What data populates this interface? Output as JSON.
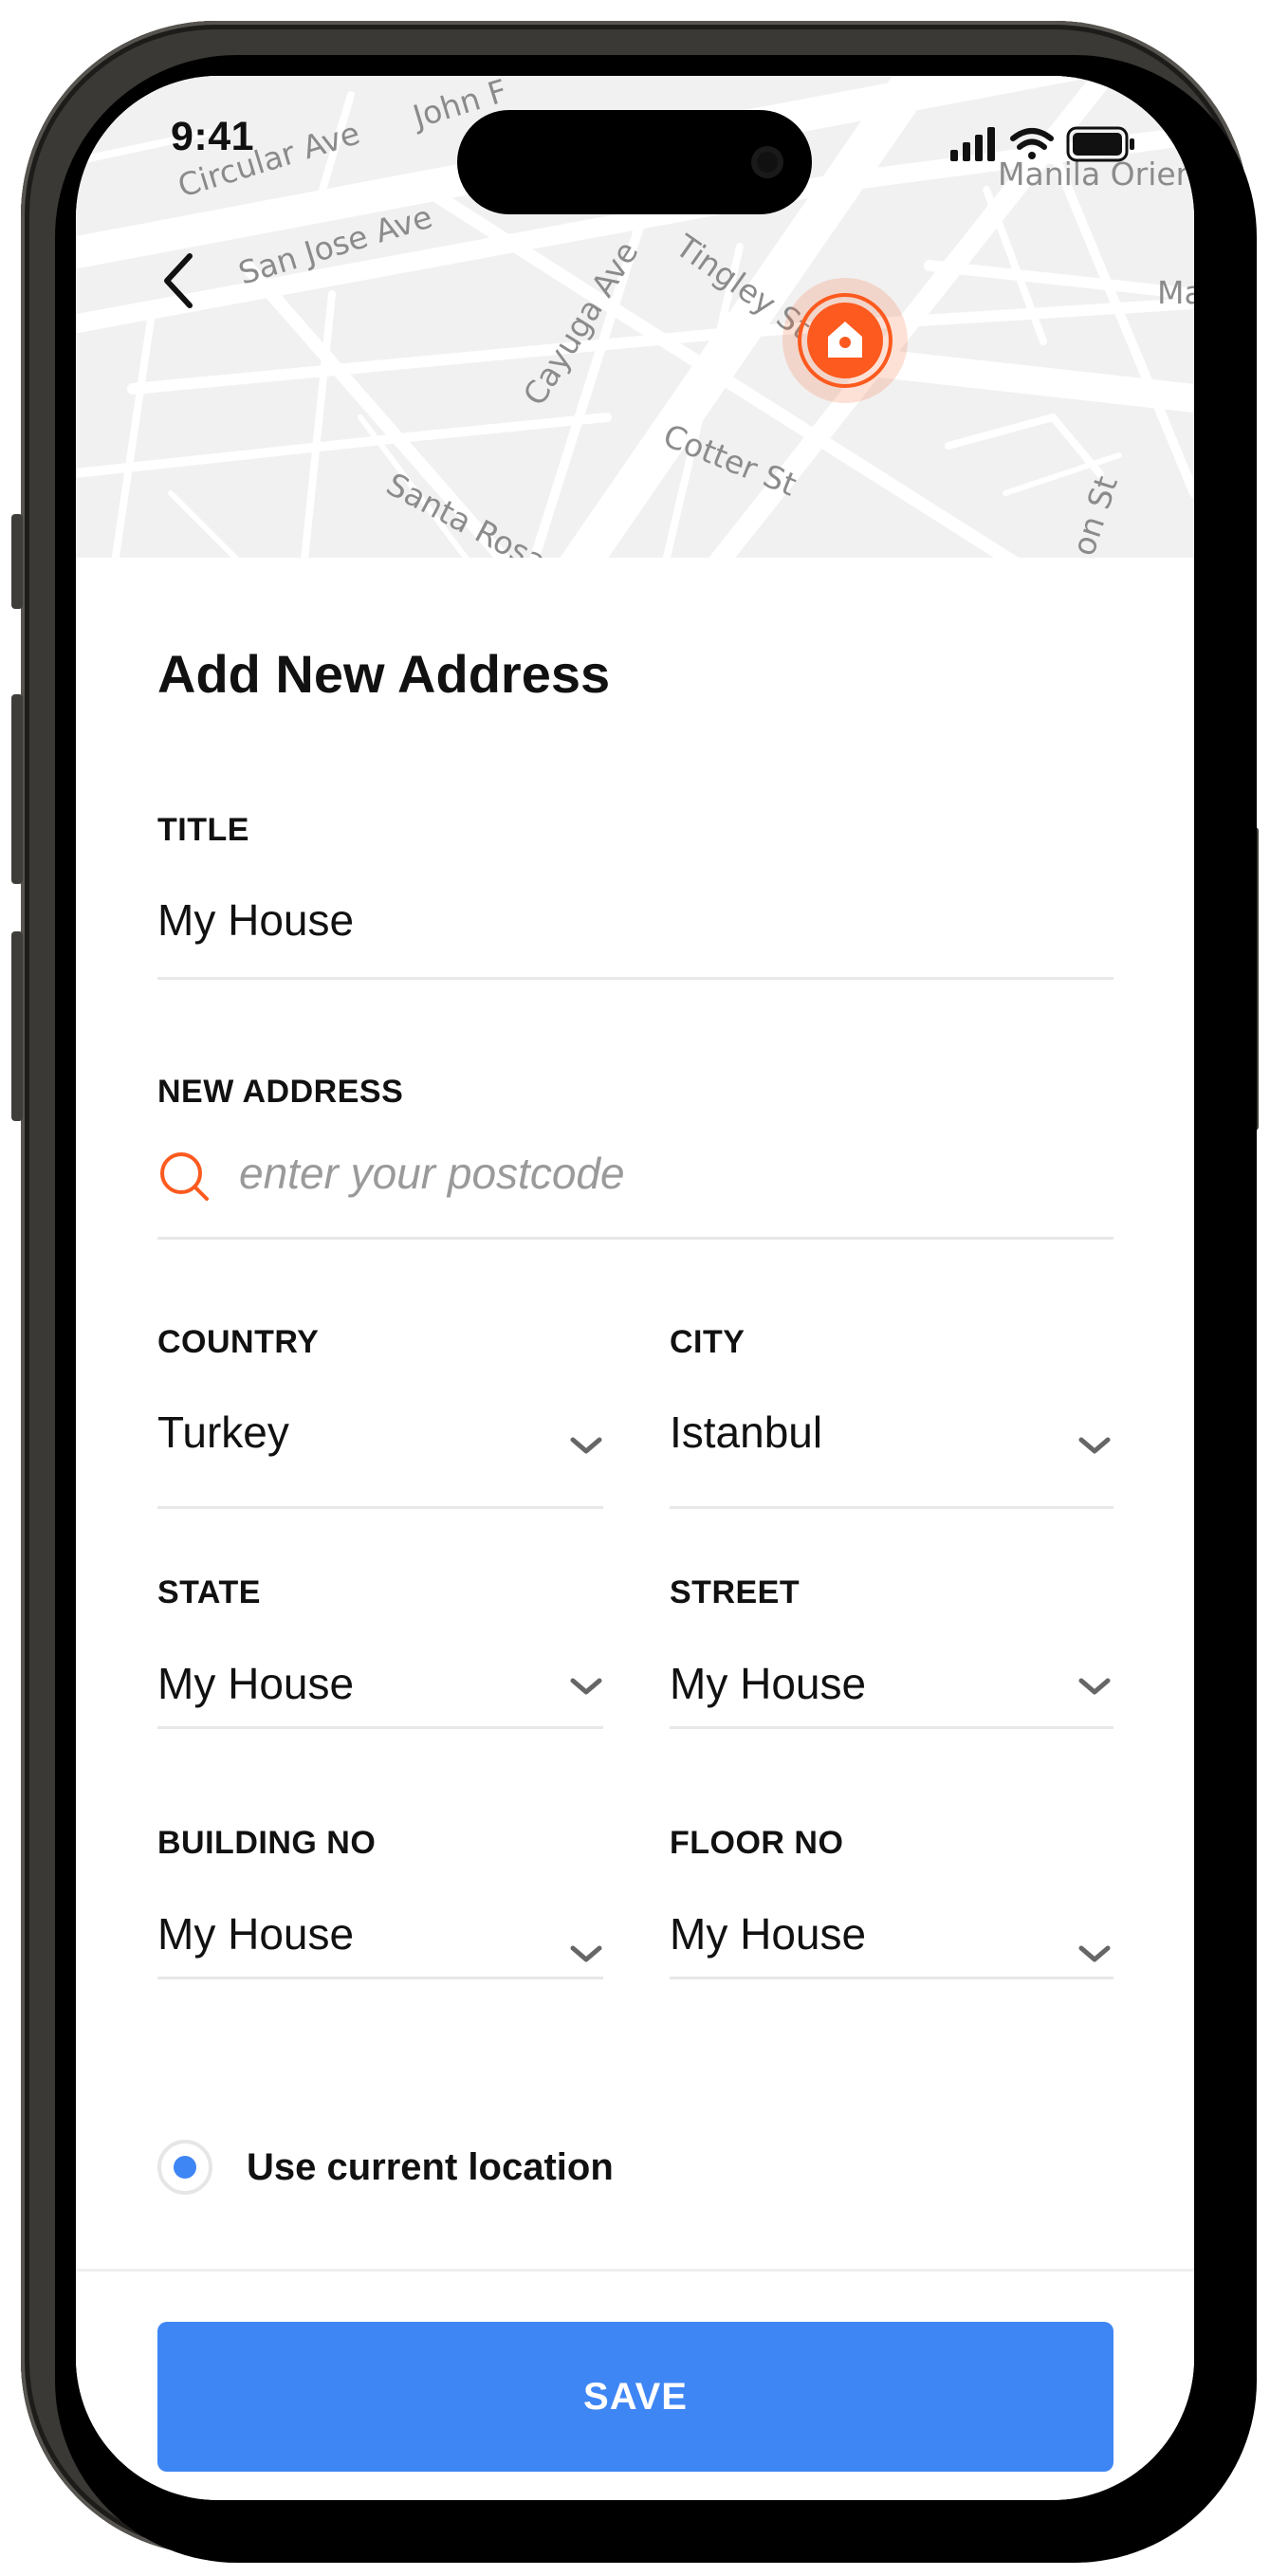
{
  "status_bar": {
    "time": "9:41"
  },
  "map": {
    "streets": [
      "Circular Ave",
      "John F",
      "San Jose Ave",
      "Tingley St",
      "Cayuga Ave",
      "Cotter St",
      "Santa Rosa",
      "Manila Orien",
      "Ma",
      "on St"
    ]
  },
  "form": {
    "heading": "Add New Address",
    "title": {
      "label": "TITLE",
      "value": "My House"
    },
    "new_address": {
      "label": "NEW ADDRESS",
      "placeholder": "enter your postcode"
    },
    "country": {
      "label": "COUNTRY",
      "value": "Turkey"
    },
    "city": {
      "label": "CITY",
      "value": "Istanbul"
    },
    "state": {
      "label": "STATE",
      "value": "My House"
    },
    "street": {
      "label": "STREET",
      "value": "My House"
    },
    "building_no": {
      "label": "BUILDING NO",
      "value": "My House"
    },
    "floor_no": {
      "label": "FLOOR NO",
      "value": "My House"
    },
    "use_current_location": {
      "label": "Use current location",
      "selected": true
    }
  },
  "save_button": {
    "label": "SAVE"
  },
  "colors": {
    "accent": "#3f86f5",
    "pin": "#fc5a1e",
    "text": "#111111"
  }
}
